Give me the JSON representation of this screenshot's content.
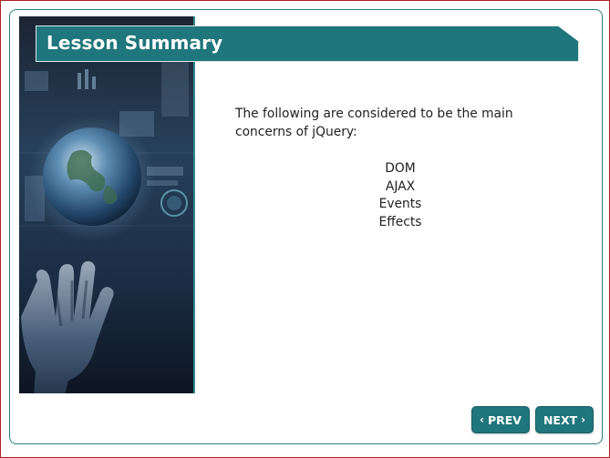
{
  "lesson": {
    "title": "Lesson Summary",
    "intro_text": "The following are considered to be the main concerns of jQuery:",
    "concerns": [
      "DOM",
      "AJAX",
      "Events",
      "Effects"
    ]
  },
  "side_image": {
    "description": "hand-holding-globe-image"
  },
  "navigation": {
    "prev_label": "PREV",
    "next_label": "NEXT",
    "prev_icon": "chevron-left-icon",
    "next_icon": "chevron-right-icon"
  },
  "colors": {
    "frame_border": "#b11e24",
    "accent_teal": "#1f767c",
    "text": "#222222"
  }
}
